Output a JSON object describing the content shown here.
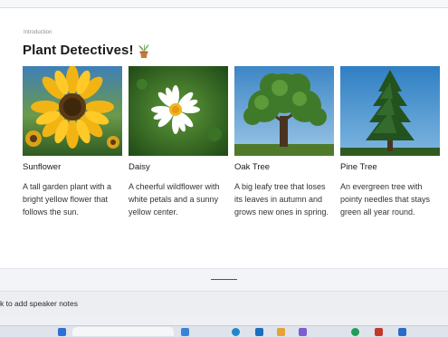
{
  "slide": {
    "label": "Introduction",
    "title": "Plant Detectives!",
    "cards": [
      {
        "name": "Sunflower",
        "description": "A tall garden plant with a bright yellow flower that follows the sun.",
        "image": "sunflower-photo"
      },
      {
        "name": "Daisy",
        "description": "A cheerful wildflower with white petals and a sunny yellow center.",
        "image": "daisy-photo"
      },
      {
        "name": "Oak Tree",
        "description": "A big leafy tree that loses its leaves in autumn and grows new ones in spring.",
        "image": "oak-tree-photo"
      },
      {
        "name": "Pine Tree",
        "description": "An evergreen tree with pointy needles that stays green all year round.",
        "image": "pine-tree-photo"
      }
    ]
  },
  "notes": {
    "placeholder": "k to add speaker notes"
  },
  "taskbar": {
    "icons": [
      "app-icon",
      "search-box",
      "widgets-icon",
      "browser-icon",
      "mail-icon",
      "files-icon",
      "chat-icon",
      "teams-icon",
      "store-icon",
      "settings-icon"
    ]
  },
  "colors": {
    "slide_bg": "#ffffff",
    "workspace_bg": "#eef0f3",
    "title_text": "#1a1a1a"
  }
}
